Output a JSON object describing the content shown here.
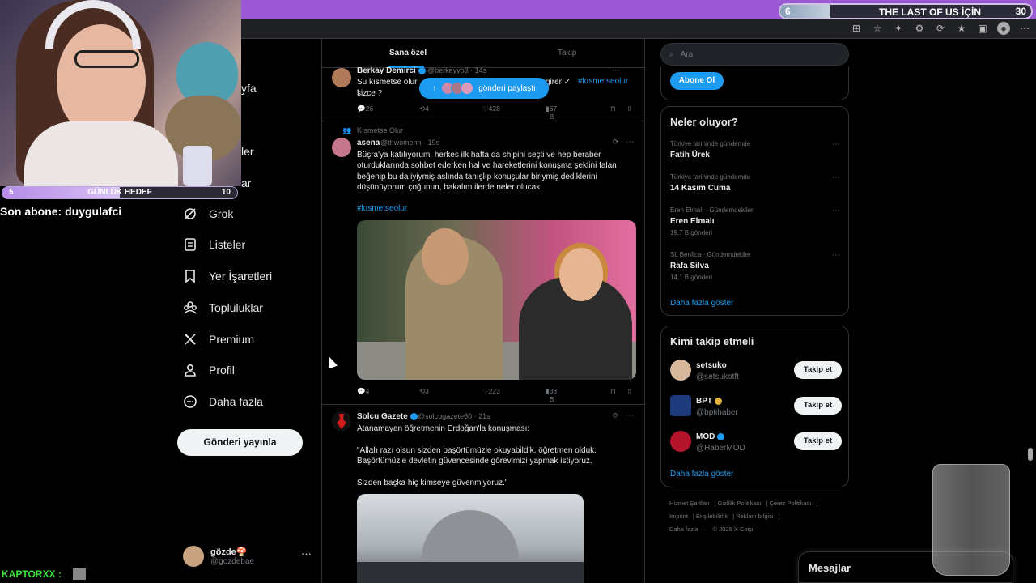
{
  "stream": {
    "top_goal": {
      "current": "6",
      "label": "THE LAST OF US İÇİN",
      "target": "30",
      "progress": 0.2
    },
    "daily_goal": {
      "current": "5",
      "label": "GÜNLÜK HEDEF",
      "target": "10",
      "progress": 0.5
    },
    "last_subscriber": "Son abone: duygulafci",
    "chat_user": "KAPTORXX :"
  },
  "nav": {
    "peek_items": [
      "yfa",
      "ler",
      "ar"
    ],
    "items": [
      {
        "label": "Grok",
        "icon": "grok-icon"
      },
      {
        "label": "Listeler",
        "icon": "lists-icon"
      },
      {
        "label": "Yer İşaretleri",
        "icon": "bookmark-icon"
      },
      {
        "label": "Topluluklar",
        "icon": "communities-icon"
      },
      {
        "label": "Premium",
        "icon": "x-logo-icon"
      },
      {
        "label": "Profil",
        "icon": "profile-icon"
      },
      {
        "label": "Daha fazla",
        "icon": "more-circle-icon"
      }
    ],
    "post_button": "Gönderi yayınla",
    "account": {
      "name": "gözde🍄",
      "handle": "@gozdebae",
      "more": "···"
    }
  },
  "feed": {
    "tabs": {
      "active": "Sana özel",
      "inactive": "Takip"
    },
    "share_pill": "gönderi paylaştı",
    "posts": [
      {
        "name": "Berkay Demirci",
        "handle": "@berkayyb3 · 14s",
        "text_a": "Su kısmetse olur t",
        "text_b": "girer ✓",
        "tag": "#kısmetseolur",
        "text_c": "sizce ?",
        "replies": "26",
        "reposts": "4",
        "likes": "428",
        "views": "67 B"
      },
      {
        "context": "Kısmetse Olur",
        "name": "asena",
        "handle": "@thwomenn · 19s",
        "text": "Büşra'ya katılıyorum. herkes ilk hafta da shipini seçti ve hep beraber oturduklarında sohbet ederken hal ve hareketlerini konuşma şeklini falan beğenip bu da iyiymiş aslında tanışlıp konuşular biriymiş dediklerini düşünüyorum çoğunun, bakalım ilerde neler olucak",
        "tag": "#kısmetseolur",
        "replies": "4",
        "reposts": "3",
        "likes": "223",
        "views": "38 B"
      },
      {
        "name": "Solcu Gazete",
        "handle": "@solcugazete60 · 21s",
        "text": "Atanamayan öğretmenin Erdoğan'la konuşması:\n\n\"Allah razı olsun sizden başörtümüzle okuyabildik, öğretmen olduk. Başörtümüzle devletin güvencesinde görevimizi yapmak istiyoruz.\n\nSizden başka hiç kimseye güvenmiyoruz.\""
      }
    ]
  },
  "right": {
    "search_placeholder": "Ara",
    "subscribe": "Abone Ol",
    "trends_title": "Neler oluyor?",
    "trends": [
      {
        "meta": "Türkiye tarihinde gündemde",
        "title": "Fatih Ürek",
        "count": ""
      },
      {
        "meta": "Türkiye tarihinde gündemde",
        "title": "14 Kasım Cuma",
        "count": ""
      },
      {
        "meta": "Eren Elmalı · Gündemdekiler",
        "title": "Eren Elmalı",
        "count": "19,7 B gönderi"
      },
      {
        "meta": "SL Benfica · Gündemdekiler",
        "title": "Rafa Silva",
        "count": "14,1 B gönderi"
      }
    ],
    "show_more": "Daha fazla göster",
    "who_title": "Kimi takip etmeli",
    "who": [
      {
        "name": "setsuko",
        "handle": "@setsukotft",
        "button": "Takip et"
      },
      {
        "name": "BPT",
        "handle": "@bptihaber",
        "button": "Takip et"
      },
      {
        "name": "MOD",
        "handle": "@HaberMOD",
        "button": "Takip et"
      }
    ],
    "footer": [
      "Hizmet Şartları",
      "Gizlilik Politikası",
      "Çerez Politikası",
      "Imprint",
      "Erişilebilirlik",
      "Reklam bilgisi",
      "Daha fazla ···",
      "© 2025 X Corp."
    ],
    "messages": "Mesajlar"
  },
  "colors": {
    "accent": "#1d9bf0",
    "stream_bar": "#9b59d6"
  }
}
